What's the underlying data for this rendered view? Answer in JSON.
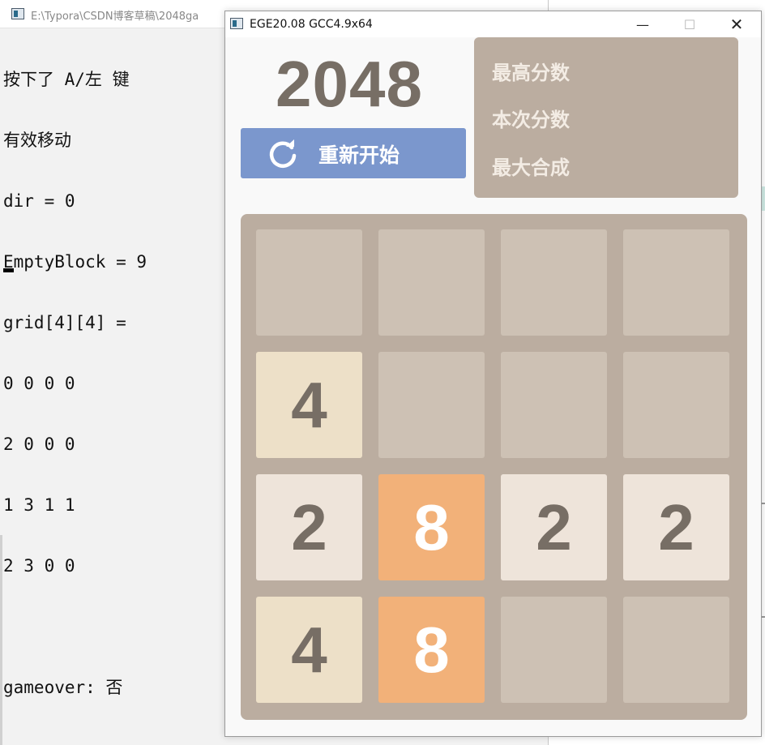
{
  "console": {
    "title": "E:\\Typora\\CSDN博客草稿\\2048ga",
    "lines": [
      "按下了 A/左 键",
      "有效移动",
      "dir = 0",
      "EmptyBlock = 9",
      "grid[4][4] =",
      "0 0 0 0",
      "2 0 0 0",
      "1 3 1 1",
      "2 3 0 0",
      "",
      "gameover: 否"
    ]
  },
  "game_window": {
    "title": "EGE20.08 GCC4.9x64",
    "controls": {
      "minimize": "—",
      "maximize": "☐",
      "close": "✕"
    }
  },
  "game": {
    "logo": "2048",
    "restart_label": "重新开始",
    "restart_icon": "refresh-icon",
    "score_labels": [
      "最高分数",
      "本次分数",
      "最大合成"
    ],
    "board": [
      [
        "",
        "",
        "",
        ""
      ],
      [
        "4",
        "",
        "",
        ""
      ],
      [
        "2",
        "8",
        "2",
        "2"
      ],
      [
        "4",
        "8",
        "",
        ""
      ]
    ]
  },
  "colors": {
    "board_bg": "#bbada0",
    "empty_tile": "#cdc1b4",
    "tile_2": "#eee4da",
    "tile_4": "#ede0c8",
    "tile_8": "#f2b179",
    "restart_button": "#7b97cd",
    "dark_text": "#776e65"
  }
}
